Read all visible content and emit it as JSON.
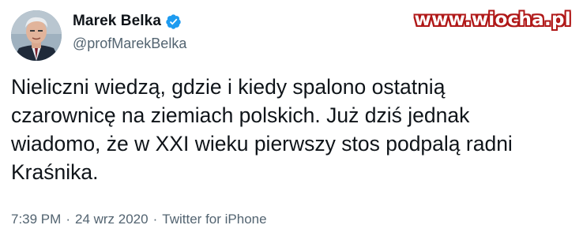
{
  "author": {
    "display_name": "Marek Belka",
    "handle": "@profMarekBelka",
    "verified": true
  },
  "watermark": "www.wiocha.pl",
  "tweet": {
    "text": "Nieliczni wiedzą, gdzie i kiedy spalono ostatnią\nczarownicę na ziemiach polskich. Już dziś jednak\nwiadomo, że w XXI wieku pierwszy stos podpalą radni\nKraśnika."
  },
  "meta": {
    "time": "7:39 PM",
    "separator": "·",
    "date": "24 wrz 2020",
    "source": "Twitter for iPhone"
  },
  "colors": {
    "text": "#0f1419",
    "secondary": "#536471",
    "verified_badge": "#1d9bf0",
    "watermark_outline": "#b01818"
  },
  "icons": {
    "verified": "verified-badge-icon"
  }
}
